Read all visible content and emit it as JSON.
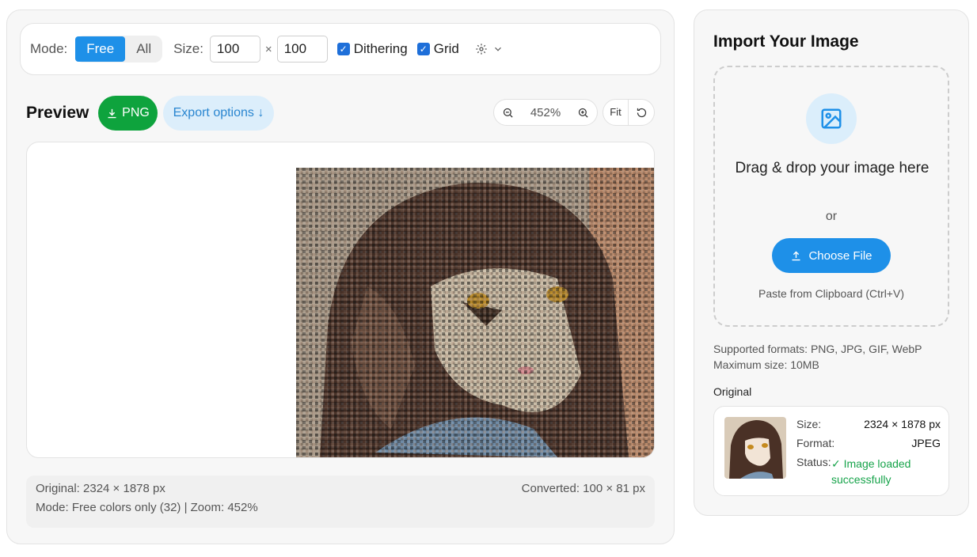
{
  "toolbar": {
    "mode_label": "Mode:",
    "mode_options": [
      "Free",
      "All"
    ],
    "mode_selected": "Free",
    "size_label": "Size:",
    "width_value": "100",
    "height_value": "100",
    "times": "×",
    "dithering_label": "Dithering",
    "dithering_checked": true,
    "grid_label": "Grid",
    "grid_checked": true,
    "settings_icon": "gear-icon"
  },
  "preview": {
    "title": "Preview",
    "png_label": "PNG",
    "export_label": "Export options ↓",
    "zoom_value": "452%",
    "fit_label": "Fit"
  },
  "info": {
    "original": "Original: 2324 × 1878 px",
    "mode_zoom": "Mode: Free colors only (32) | Zoom: 452%",
    "converted": "Converted: 100 × 81 px"
  },
  "import": {
    "title": "Import Your Image",
    "drop_text": "Drag & drop your image here",
    "or_text": "or",
    "choose_label": "Choose File",
    "paste_label": "Paste from Clipboard (Ctrl+V)",
    "formats_line1": "Supported formats: PNG, JPG, GIF, WebP",
    "formats_line2": "Maximum size: 10MB",
    "original_label": "Original",
    "size_key": "Size:",
    "size_val": "2324 × 1878 px",
    "format_key": "Format:",
    "format_val": "JPEG",
    "status_key": "Status:",
    "status_val": "✓ Image loaded successfully"
  },
  "colors": {
    "accent_blue": "#1e90e8",
    "png_green": "#0ea33d",
    "status_green": "#16a34a"
  }
}
